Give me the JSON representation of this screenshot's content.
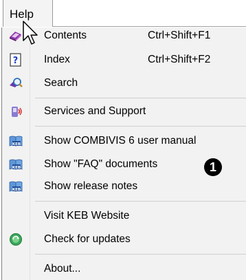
{
  "menubar": {
    "help_label": "Help"
  },
  "menu": {
    "items": [
      {
        "label": "Contents",
        "shortcut": "Ctrl+Shift+F1",
        "icon": "book-help-icon"
      },
      {
        "label": "Index",
        "shortcut": "Ctrl+Shift+F2",
        "icon": "question-index-icon"
      },
      {
        "label": "Search",
        "icon": "search-magnifier-icon"
      },
      {
        "label": "Services and Support",
        "icon": "phone-support-icon"
      },
      {
        "label": "Show COMBIVIS 6 user manual",
        "icon": "keb-manual-icon"
      },
      {
        "label": "Show \"FAQ\" documents",
        "icon": "keb-manual-icon"
      },
      {
        "label": "Show release notes",
        "icon": "keb-manual-icon"
      },
      {
        "label": "Visit KEB Website"
      },
      {
        "label": "Check for updates",
        "icon": "update-globe-icon"
      },
      {
        "label": "About..."
      }
    ]
  },
  "callout": {
    "number": "1"
  }
}
